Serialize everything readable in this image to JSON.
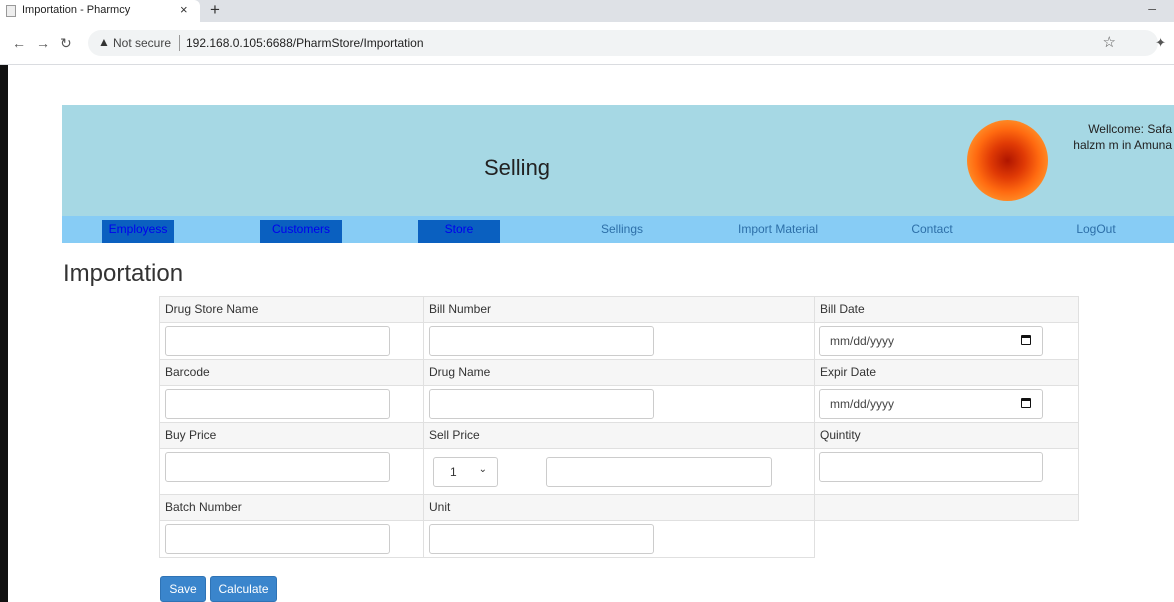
{
  "browser": {
    "tab_title": "Importation - Pharmcy",
    "tab_close": "×",
    "new_tab": "+",
    "minimize": "–",
    "not_secure": "Not secure",
    "url": "192.168.0.105:6688/PharmStore/Importation"
  },
  "header": {
    "title": "Selling",
    "welcome": "Wellcome: Safa halzm m in Amuna"
  },
  "menu": {
    "items": [
      {
        "label": "Employess",
        "active": true
      },
      {
        "label": "Customers",
        "active": true
      },
      {
        "label": "Store",
        "active": true
      },
      {
        "label": "Sellings",
        "active": false
      },
      {
        "label": "Import Material",
        "active": false
      },
      {
        "label": "Contact",
        "active": false
      },
      {
        "label": "LogOut",
        "active": false
      }
    ]
  },
  "page": {
    "heading": "Importation"
  },
  "form": {
    "drug_store_name": {
      "label": "Drug Store Name",
      "value": ""
    },
    "bill_number": {
      "label": "Bill Number",
      "value": ""
    },
    "bill_date": {
      "label": "Bill Date",
      "placeholder": "mm/dd/yyyy"
    },
    "barcode": {
      "label": "Barcode",
      "value": ""
    },
    "drug_name": {
      "label": "Drug Name",
      "value": ""
    },
    "expir_date": {
      "label": "Expir Date",
      "placeholder": "mm/dd/yyyy"
    },
    "buy_price": {
      "label": "Buy Price",
      "value": ""
    },
    "sell_price": {
      "label": "Sell Price",
      "select_value": "1",
      "value": ""
    },
    "quintity": {
      "label": "Quintity",
      "value": ""
    },
    "batch_number": {
      "label": "Batch Number",
      "value": ""
    },
    "unit": {
      "label": "Unit",
      "value": ""
    }
  },
  "actions": {
    "save": "Save",
    "calculate": "Calculate"
  },
  "colors": {
    "banner": "#a6d8e4",
    "menubar": "#87ccf5",
    "menu_active": "#0a60c0",
    "button": "#3a85cc"
  }
}
